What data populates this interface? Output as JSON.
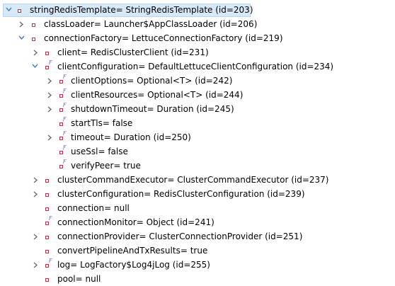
{
  "tree": {
    "rows": [
      {
        "label": "stringRedisTemplate= StringRedisTemplate  (id=203)",
        "twisty": "expanded",
        "final": false
      },
      {
        "label": "classLoader= Launcher$AppClassLoader  (id=206)",
        "twisty": "collapsed",
        "final": false
      },
      {
        "label": "connectionFactory= LettuceConnectionFactory  (id=219)",
        "twisty": "expanded",
        "final": false
      },
      {
        "label": "client= RedisClusterClient  (id=231)",
        "twisty": "collapsed",
        "final": false
      },
      {
        "label": "clientConfiguration= DefaultLettuceClientConfiguration  (id=234)",
        "twisty": "expanded",
        "final": true
      },
      {
        "label": "clientOptions= Optional<T>  (id=242)",
        "twisty": "collapsed",
        "final": true
      },
      {
        "label": "clientResources= Optional<T>  (id=244)",
        "twisty": "collapsed",
        "final": true
      },
      {
        "label": "shutdownTimeout= Duration  (id=245)",
        "twisty": "collapsed",
        "final": true
      },
      {
        "label": "startTls= false",
        "twisty": "none",
        "final": true
      },
      {
        "label": "timeout= Duration  (id=250)",
        "twisty": "collapsed",
        "final": true
      },
      {
        "label": "useSsl= false",
        "twisty": "none",
        "final": true
      },
      {
        "label": "verifyPeer= true",
        "twisty": "none",
        "final": true
      },
      {
        "label": "clusterCommandExecutor= ClusterCommandExecutor  (id=237)",
        "twisty": "collapsed",
        "final": false
      },
      {
        "label": "clusterConfiguration= RedisClusterConfiguration  (id=239)",
        "twisty": "collapsed",
        "final": false
      },
      {
        "label": "connection= null",
        "twisty": "none",
        "final": false
      },
      {
        "label": "connectionMonitor= Object  (id=241)",
        "twisty": "none",
        "final": true
      },
      {
        "label": "connectionProvider= ClusterConnectionProvider  (id=251)",
        "twisty": "collapsed",
        "final": false
      },
      {
        "label": "convertPipelineAndTxResults= true",
        "twisty": "none",
        "final": false
      },
      {
        "label": "log= LogFactory$Log4jLog  (id=255)",
        "twisty": "collapsed",
        "final": true
      },
      {
        "label": "pool= null",
        "twisty": "none",
        "final": false
      }
    ]
  },
  "colors": {
    "field_icon_border": "#c8294a",
    "final_marker": "#7a5fb0",
    "selection_bg": "#d7e8f7",
    "twisty": "#6b6b6b"
  }
}
